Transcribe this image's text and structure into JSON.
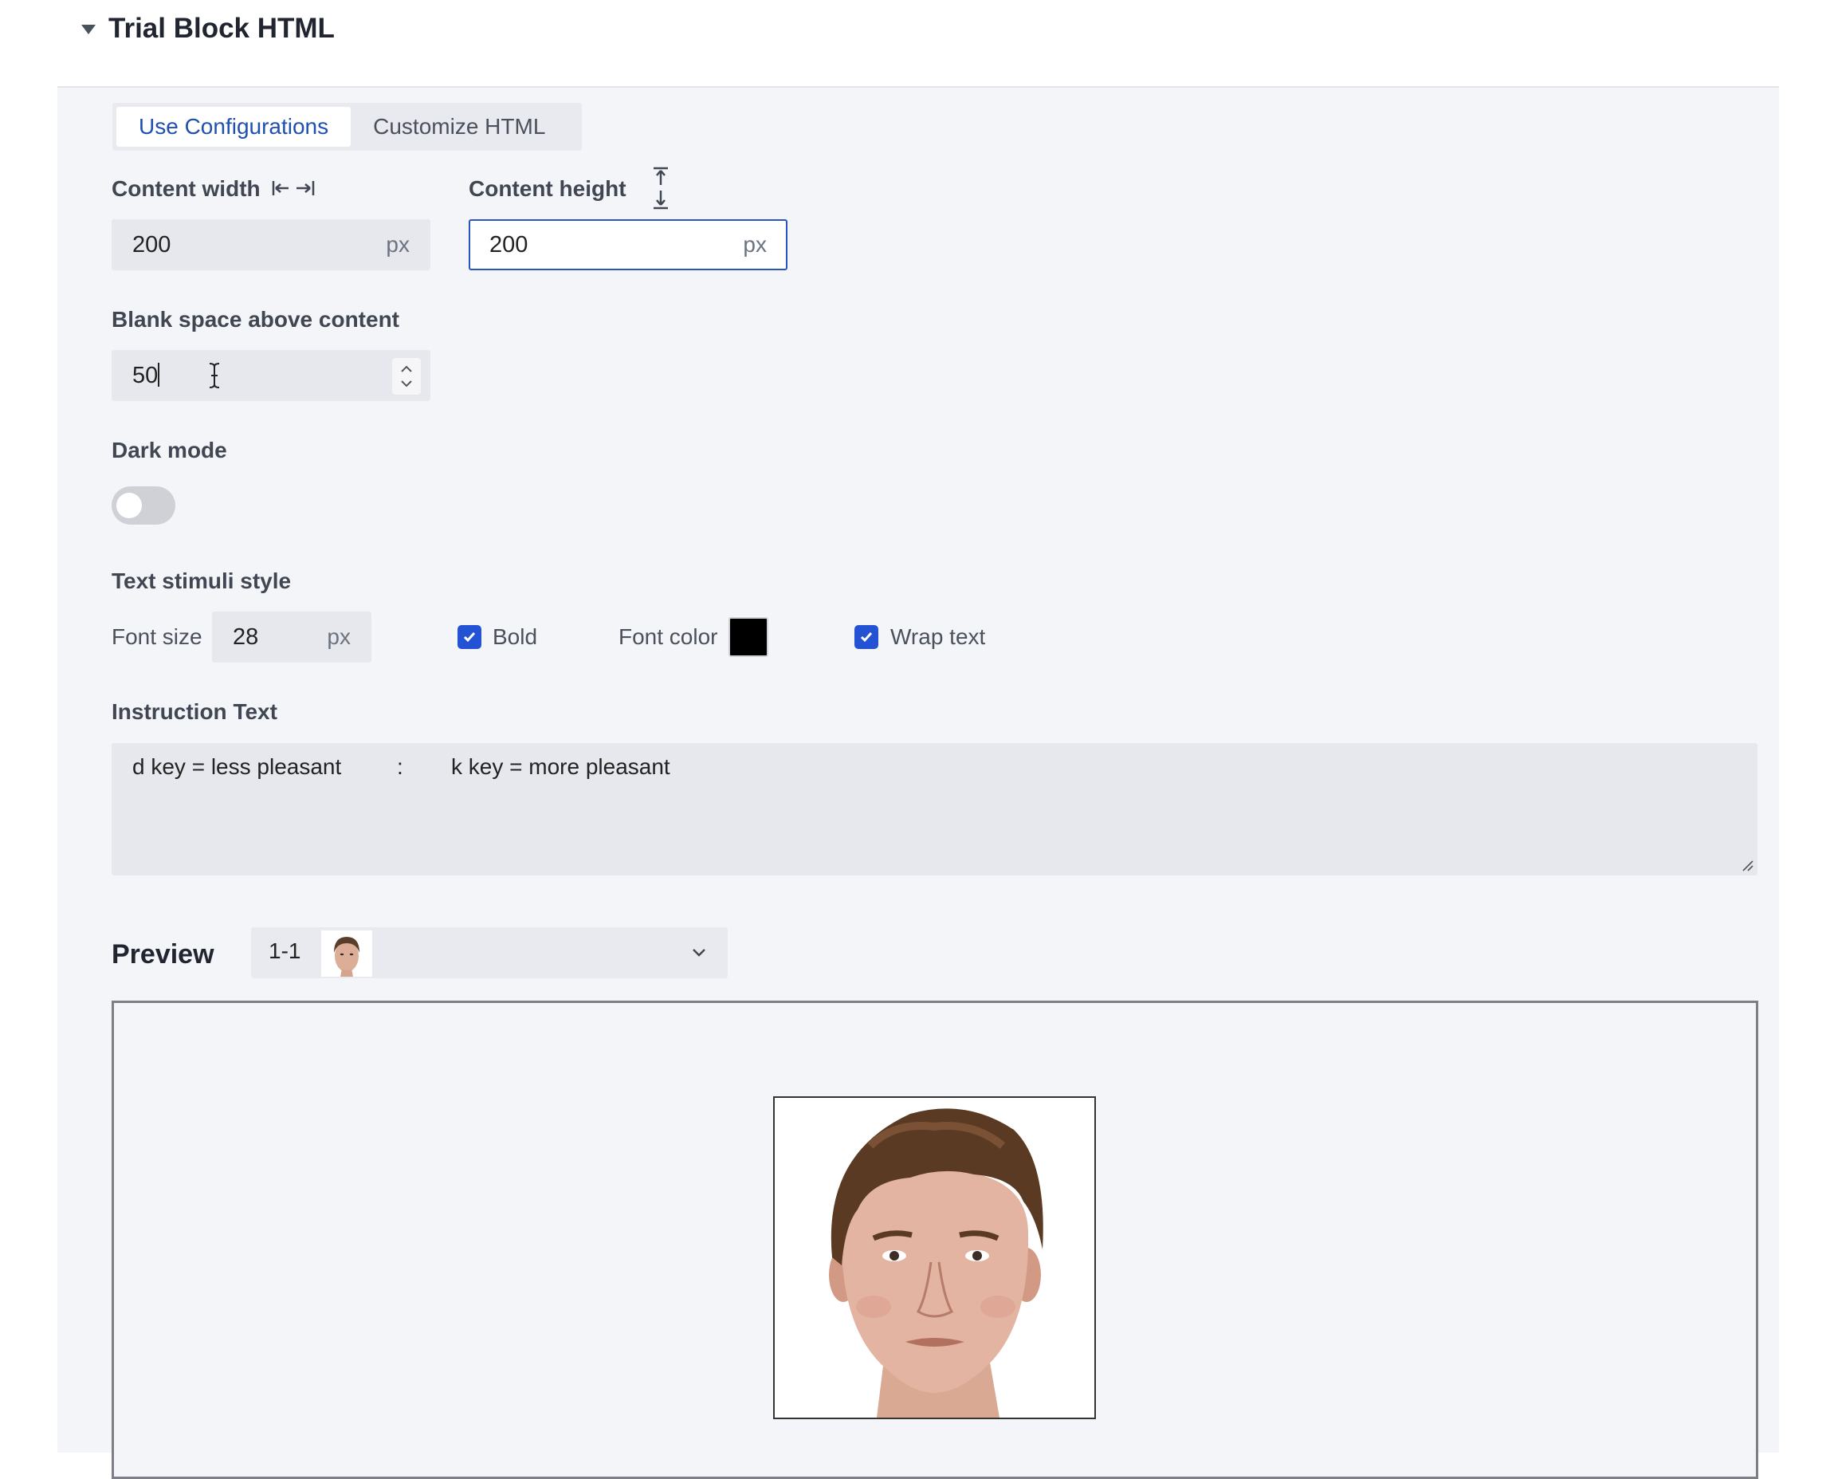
{
  "section": {
    "title": "Trial Block HTML"
  },
  "tabs": [
    {
      "label": "Use Configurations",
      "active": true
    },
    {
      "label": "Customize HTML",
      "active": false
    }
  ],
  "content_width": {
    "label": "Content width",
    "value": "200",
    "unit": "px"
  },
  "content_height": {
    "label": "Content height",
    "value": "200",
    "unit": "px"
  },
  "blank_space": {
    "label": "Blank space above content",
    "value": "50"
  },
  "dark_mode": {
    "label": "Dark mode",
    "enabled": false
  },
  "text_style": {
    "label": "Text stimuli style",
    "font_size_label": "Font size",
    "font_size_value": "28",
    "font_size_unit": "px",
    "bold_label": "Bold",
    "bold_checked": true,
    "font_color_label": "Font color",
    "font_color": "#000000",
    "wrap_label": "Wrap text",
    "wrap_checked": true
  },
  "instruction": {
    "label": "Instruction Text",
    "left": "d key = less pleasant",
    "separator": ":",
    "right": "k key = more pleasant"
  },
  "preview": {
    "label": "Preview",
    "selected": "1-1"
  },
  "colors": {
    "accent": "#2352d4",
    "tab_active_text": "#1f4fb0",
    "panel_bg": "#f4f5f9"
  }
}
